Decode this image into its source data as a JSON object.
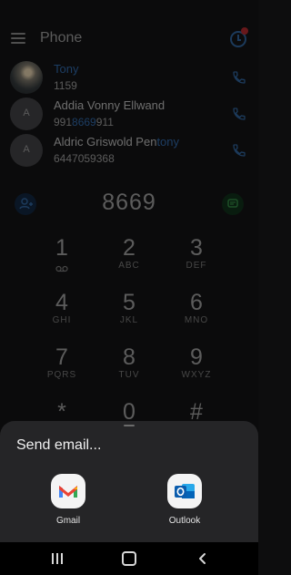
{
  "header": {
    "title": "Phone"
  },
  "contacts": [
    {
      "name": "Tony",
      "number": "1159",
      "initial": ""
    },
    {
      "name_pre": "Addia Vonny Ellwand",
      "number_pre": "991",
      "number_hl": "8669",
      "number_post": "911",
      "initial": "A"
    },
    {
      "name_pre": "Aldric Griswold Pen",
      "name_hl": "tony",
      "number": "6447059368",
      "initial": "A"
    }
  ],
  "dialpad": {
    "entered": "8669",
    "keys": [
      {
        "digit": "1",
        "letters": ""
      },
      {
        "digit": "2",
        "letters": "ABC"
      },
      {
        "digit": "3",
        "letters": "DEF"
      },
      {
        "digit": "4",
        "letters": "GHI"
      },
      {
        "digit": "5",
        "letters": "JKL"
      },
      {
        "digit": "6",
        "letters": "MNO"
      },
      {
        "digit": "7",
        "letters": "PQRS"
      },
      {
        "digit": "8",
        "letters": "TUV"
      },
      {
        "digit": "9",
        "letters": "WXYZ"
      },
      {
        "digit": "*",
        "letters": ""
      },
      {
        "digit": "0",
        "letters": ""
      },
      {
        "digit": "#",
        "letters": ""
      }
    ]
  },
  "sheet": {
    "title": "Send email...",
    "apps": [
      {
        "label": "Gmail",
        "icon": "gmail-icon"
      },
      {
        "label": "Outlook",
        "icon": "outlook-icon"
      }
    ]
  },
  "colors": {
    "accent": "#2c5e98",
    "sheet_bg": "#252527",
    "badge": "#a0262a"
  }
}
